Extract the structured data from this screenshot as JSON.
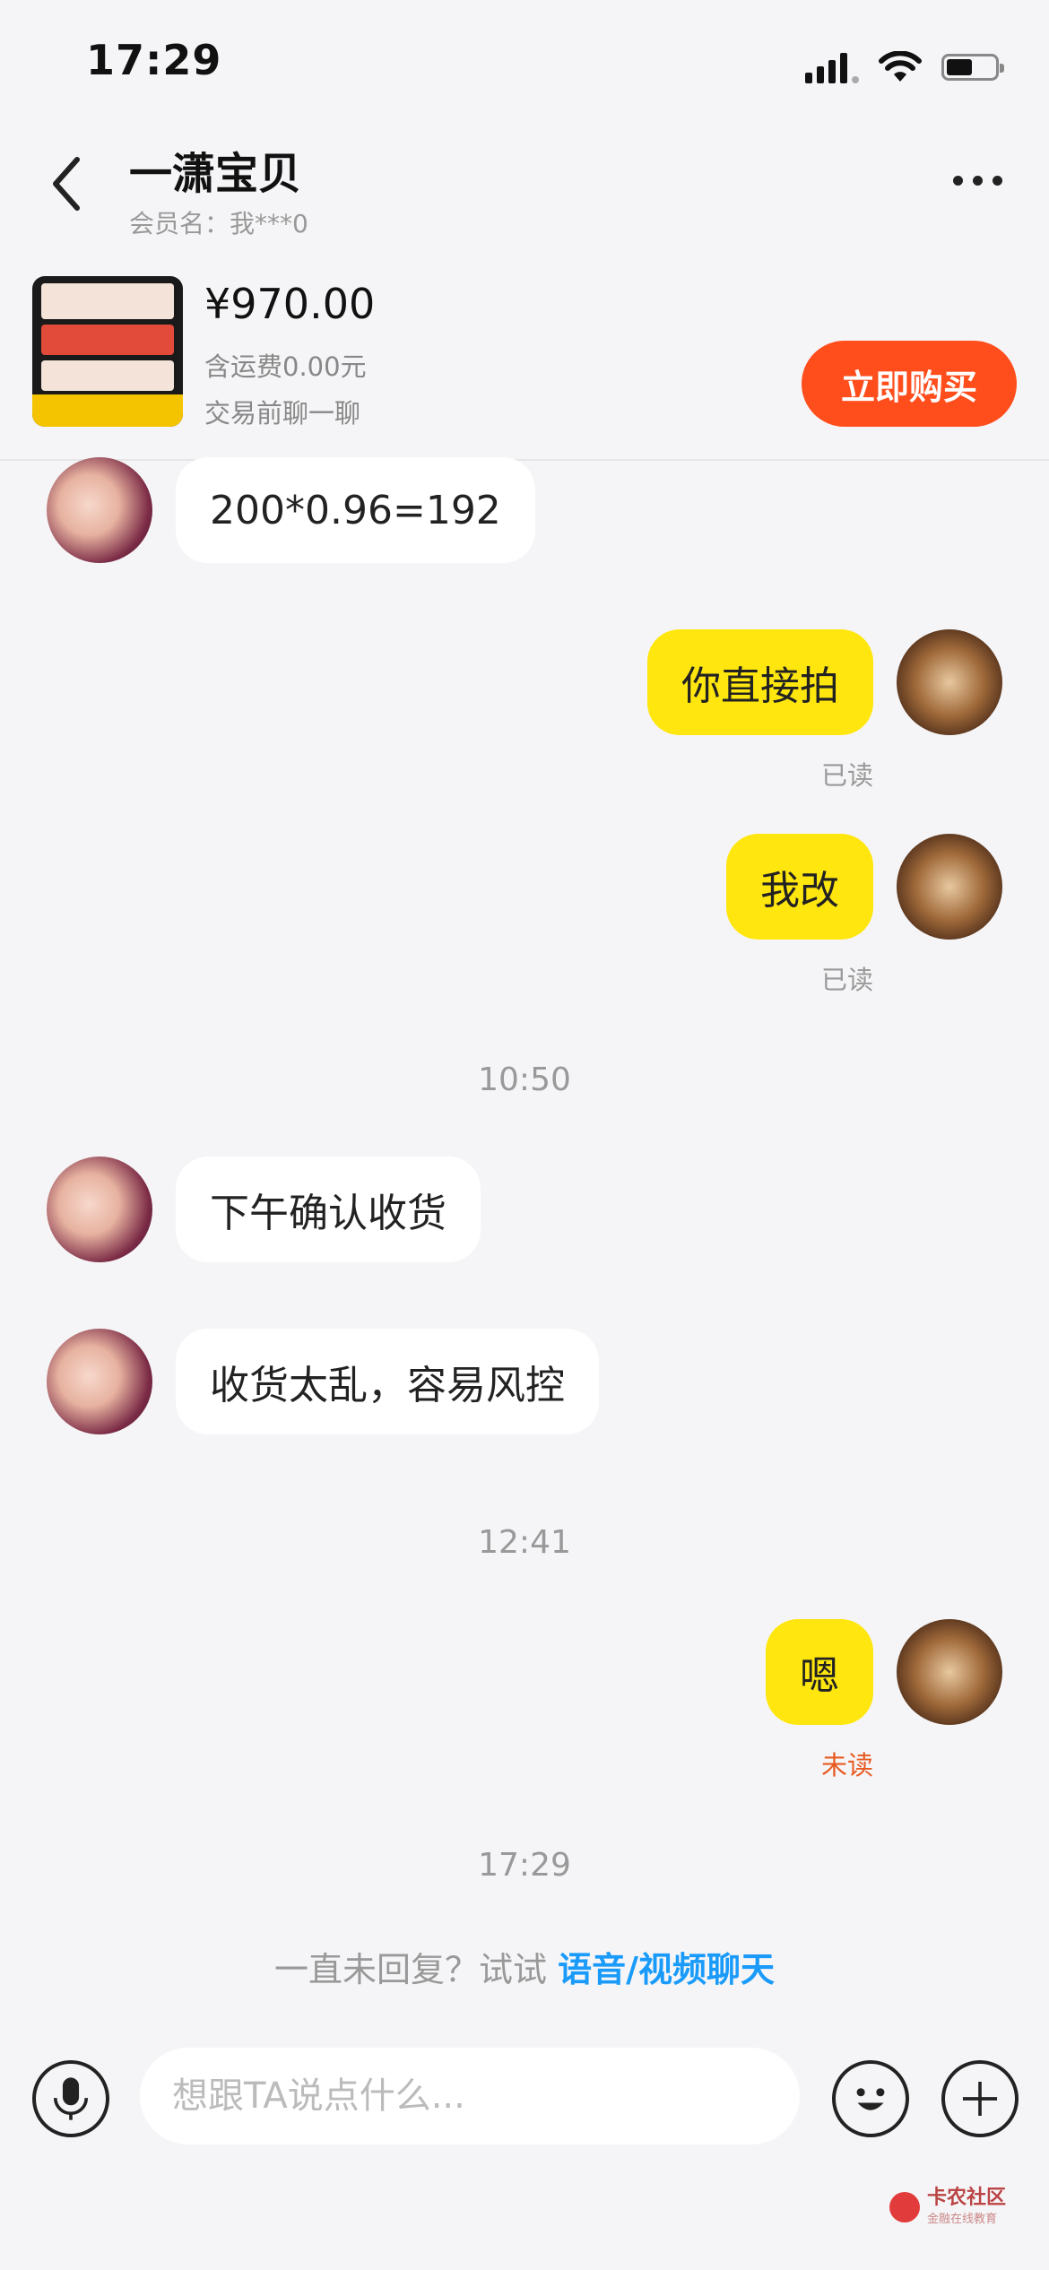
{
  "status_bar": {
    "time": "17:29"
  },
  "header": {
    "title": "一潇宝贝",
    "subtitle": "会员名：我***0"
  },
  "product": {
    "price": "¥970.00",
    "shipping": "含运费0.00元",
    "note": "交易前聊一聊",
    "buy_label": "立即购买"
  },
  "messages": [
    {
      "side": "left",
      "text": "200*0.96=192"
    },
    {
      "side": "right",
      "text": "你直接拍",
      "status": "已读"
    },
    {
      "side": "right",
      "text": "我改",
      "status": "已读"
    },
    {
      "type": "time",
      "text": "10:50"
    },
    {
      "side": "left",
      "text": "下午确认收货"
    },
    {
      "side": "left",
      "text": "收货太乱，容易风控"
    },
    {
      "type": "time",
      "text": "12:41"
    },
    {
      "side": "right",
      "text": "嗯",
      "status": "未读"
    },
    {
      "type": "time",
      "text": "17:29"
    }
  ],
  "hint": {
    "prefix": "一直未回复？试试 ",
    "link": "语音/视频聊天"
  },
  "input": {
    "placeholder": "想跟TA说点什么..."
  },
  "watermark": {
    "name": "卡农社区",
    "slogan": "金融在线教育"
  },
  "colors": {
    "accent": "#ff4d1c",
    "bubble_self": "#ffe60f",
    "link": "#1a9bfa",
    "unread": "#e85a21"
  }
}
